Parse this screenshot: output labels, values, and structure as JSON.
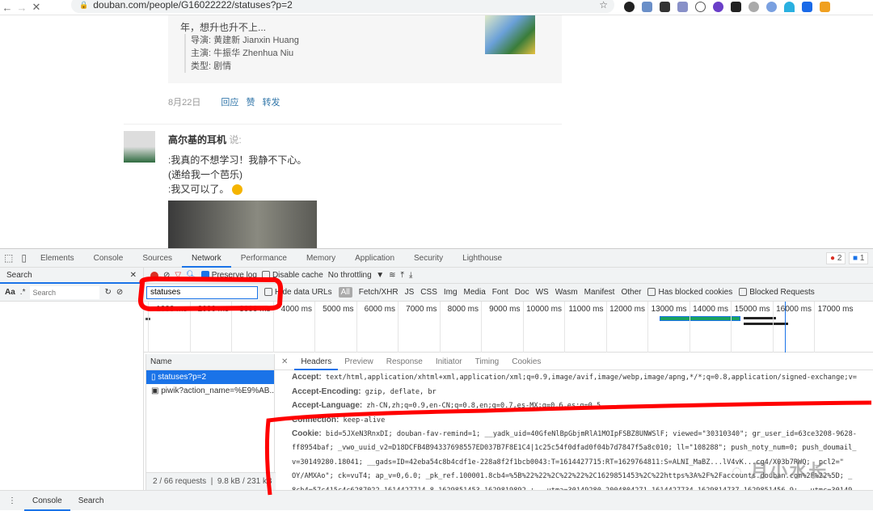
{
  "browser": {
    "url": "douban.com/people/G16022222/statuses?p=2",
    "back": "←",
    "forward": "→",
    "stop": "✕",
    "star": "☆"
  },
  "page": {
    "card_text": "年，想升也升不上...",
    "meta": [
      "导演: 黄建新 Jianxin Huang",
      "主演: 牛振华 Zhenhua Niu",
      "类型: 剧情"
    ],
    "date": "8月22日",
    "actions": [
      "回应",
      "赞",
      "转发"
    ],
    "user": "高尔基的耳机",
    "said": "说:",
    "post_lines": [
      ":我真的不想学习！我静不下心。",
      "(递给我一个芭乐)",
      ":我又可以了。"
    ]
  },
  "devtools": {
    "tabs": [
      "Elements",
      "Console",
      "Sources",
      "Network",
      "Performance",
      "Memory",
      "Application",
      "Security",
      "Lighthouse"
    ],
    "active_tab": "Network",
    "errors": "2",
    "messages": "1",
    "search_pane": {
      "title": "Search",
      "case": "Aa",
      "regex": ".*",
      "placeholder": "Search"
    },
    "toolbar": {
      "preserve_log": "Preserve log",
      "disable_cache": "Disable cache",
      "throttling": "No throttling"
    },
    "filter": {
      "value": "statuses",
      "hide_data_urls": "Hide data URLs",
      "all": "All",
      "types": [
        "Fetch/XHR",
        "JS",
        "CSS",
        "Img",
        "Media",
        "Font",
        "Doc",
        "WS",
        "Wasm",
        "Manifest",
        "Other"
      ],
      "blocked_cookies": "Has blocked cookies",
      "blocked_requests": "Blocked Requests"
    },
    "timeline_ticks": [
      "1000 ms",
      "2000 ms",
      "3000 ms",
      "4000 ms",
      "5000 ms",
      "6000 ms",
      "7000 ms",
      "8000 ms",
      "9000 ms",
      "10000 ms",
      "11000 ms",
      "12000 ms",
      "13000 ms",
      "14000 ms",
      "15000 ms",
      "16000 ms",
      "17000 ms"
    ],
    "requests": {
      "header": "Name",
      "rows": [
        "statuses?p=2",
        "piwik?action_name=%E9%AB..."
      ],
      "footer_count": "2 / 66 requests",
      "footer_size": "9.8 kB / 231 kB"
    },
    "detail_tabs": [
      "Headers",
      "Preview",
      "Response",
      "Initiator",
      "Timing",
      "Cookies"
    ],
    "headers": [
      {
        "k": "Accept:",
        "v": "text/html,application/xhtml+xml,application/xml;q=0.9,image/avif,image/webp,image/apng,*/*;q=0.8,application/signed-exchange;v="
      },
      {
        "k": "Accept-Encoding:",
        "v": "gzip, deflate, br"
      },
      {
        "k": "Accept-Language:",
        "v": "zh-CN,zh;q=0.9,en-CN;q=0.8,en;q=0.7,es-MX;q=0.6,es;q=0.5"
      },
      {
        "k": "Connection:",
        "v": "keep-alive"
      },
      {
        "k": "Cookie:",
        "v": "bid=5JXeN3RnxDI; douban-fav-remind=1; __yadk_uid=40GfeNlBpGbjmRlA1MOIpFSBZ8UNWSlF; viewed=\"30310340\"; gr_user_id=63ce3208-9628-"
      }
    ],
    "cookie_cont": [
      "ff8954baf; _vwo_uuid_v2=D18DCFB4B94337698557ED037B7F8E1C4|1c25c54f0dfad0f04b7d7847f5a8c010; ll=\"108288\"; push_noty_num=0; push_doumail_",
      "v=30149280.18041; __gads=ID=42eba54c8b4cdf1e-228a8f2f1bcb0043:T=1614427715:RT=1629764811:S=ALNI_MaBZ...lV4vK...cg4/X03b7RWQ; _pcl2=\"",
      "OY/AMXAo\"; ck=vuT4; ap_v=0,6.0; _pk_ref.100001.8cb4=%5B%22%22%2C%22%22%2C1629851453%2C%22https%3A%2F%2Faccounts.douban.com%2F%22%5D; _",
      "8cb4=57c415c4c6287022.1614427714.8.1629851453.1629819892.; __utma=30149280.2004804271.1614427734.1629814737.1629851456.9; __utmc=30149"
    ],
    "drawer": [
      "Console",
      "Search"
    ]
  },
  "watermark": "月小水长",
  "colors": {
    "accent": "#1a73e8",
    "annotation": "#ff0000"
  }
}
